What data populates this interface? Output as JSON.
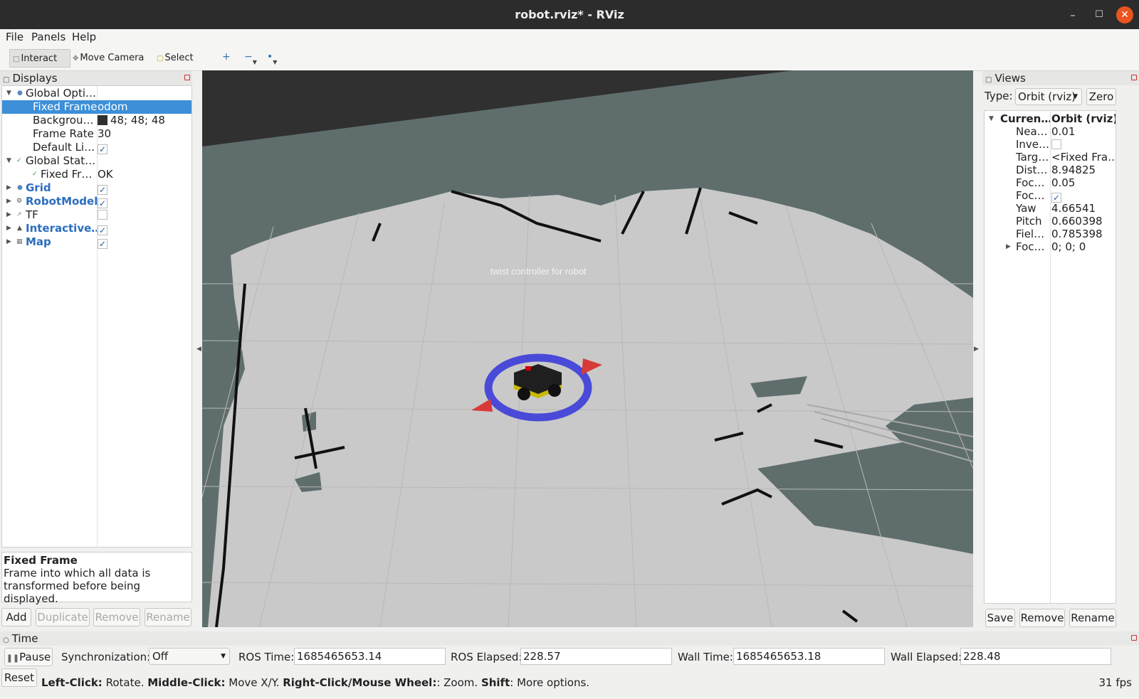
{
  "window": {
    "title": "robot.rviz* - RViz"
  },
  "menu": {
    "file": "File",
    "panels": "Panels",
    "help": "Help"
  },
  "toolbar": {
    "interact": "Interact",
    "move_camera": "Move Camera",
    "select": "Select"
  },
  "displays": {
    "title": "Displays",
    "rows": {
      "global_options": "Global Opti…",
      "fixed_frame_label": "Fixed Frame",
      "fixed_frame_value": "odom",
      "background_label": "Backgrou…",
      "background_value": "48; 48; 48",
      "frame_rate_label": "Frame Rate",
      "frame_rate_value": "30",
      "default_light_label": "Default Li…",
      "global_status": "Global Stat…",
      "fixed_frame_status_label": "Fixed Fr…",
      "fixed_frame_status_value": "OK",
      "grid": "Grid",
      "robot_model": "RobotModel",
      "tf": "TF",
      "interactive": "Interactive…",
      "map": "Map"
    },
    "description": {
      "title": "Fixed Frame",
      "text": "Frame into which all data is transformed before being displayed."
    },
    "buttons": {
      "add": "Add",
      "duplicate": "Duplicate",
      "remove": "Remove",
      "rename": "Rename"
    }
  },
  "viewport": {
    "marker_text": "twist   controller   for   robot",
    "background_color": "#303030",
    "ground_color": "#5f6e6c",
    "free_color": "#c9c9c9"
  },
  "views": {
    "title": "Views",
    "type_label": "Type:",
    "type_value": "Orbit (rviz)",
    "zero": "Zero",
    "current_label": "Curren…",
    "current_value": "Orbit (rviz)",
    "rows": [
      {
        "k": "Nea…",
        "v": "0.01"
      },
      {
        "k": "Inve…",
        "v": ""
      },
      {
        "k": "Targ…",
        "v": "<Fixed Fra…"
      },
      {
        "k": "Dist…",
        "v": "8.94825"
      },
      {
        "k": "Foc…",
        "v": "0.05"
      },
      {
        "k": "Foc…",
        "v": ""
      },
      {
        "k": "Yaw",
        "v": "4.66541"
      },
      {
        "k": "Pitch",
        "v": "0.660398"
      },
      {
        "k": "Fiel…",
        "v": "0.785398"
      },
      {
        "k": "Foc…",
        "v": "0; 0; 0"
      }
    ],
    "buttons": {
      "save": "Save",
      "remove": "Remove",
      "rename": "Rename"
    }
  },
  "time": {
    "title": "Time",
    "pause": "Pause",
    "sync_label": "Synchronization:",
    "sync_value": "Off",
    "ros_time_label": "ROS Time:",
    "ros_time_value": "1685465653.14",
    "ros_elapsed_label": "ROS Elapsed:",
    "ros_elapsed_value": "228.57",
    "wall_time_label": "Wall Time:",
    "wall_time_value": "1685465653.18",
    "wall_elapsed_label": "Wall Elapsed:",
    "wall_elapsed_value": "228.48"
  },
  "status": {
    "reset": "Reset",
    "b1": "Left-Click:",
    "t1": " Rotate. ",
    "b2": "Middle-Click:",
    "t2": " Move X/Y. ",
    "b3": "Right-Click/Mouse Wheel:",
    "t3": ": Zoom. ",
    "b4": "Shift",
    "t4": ": More options.",
    "fps": "31 fps"
  }
}
